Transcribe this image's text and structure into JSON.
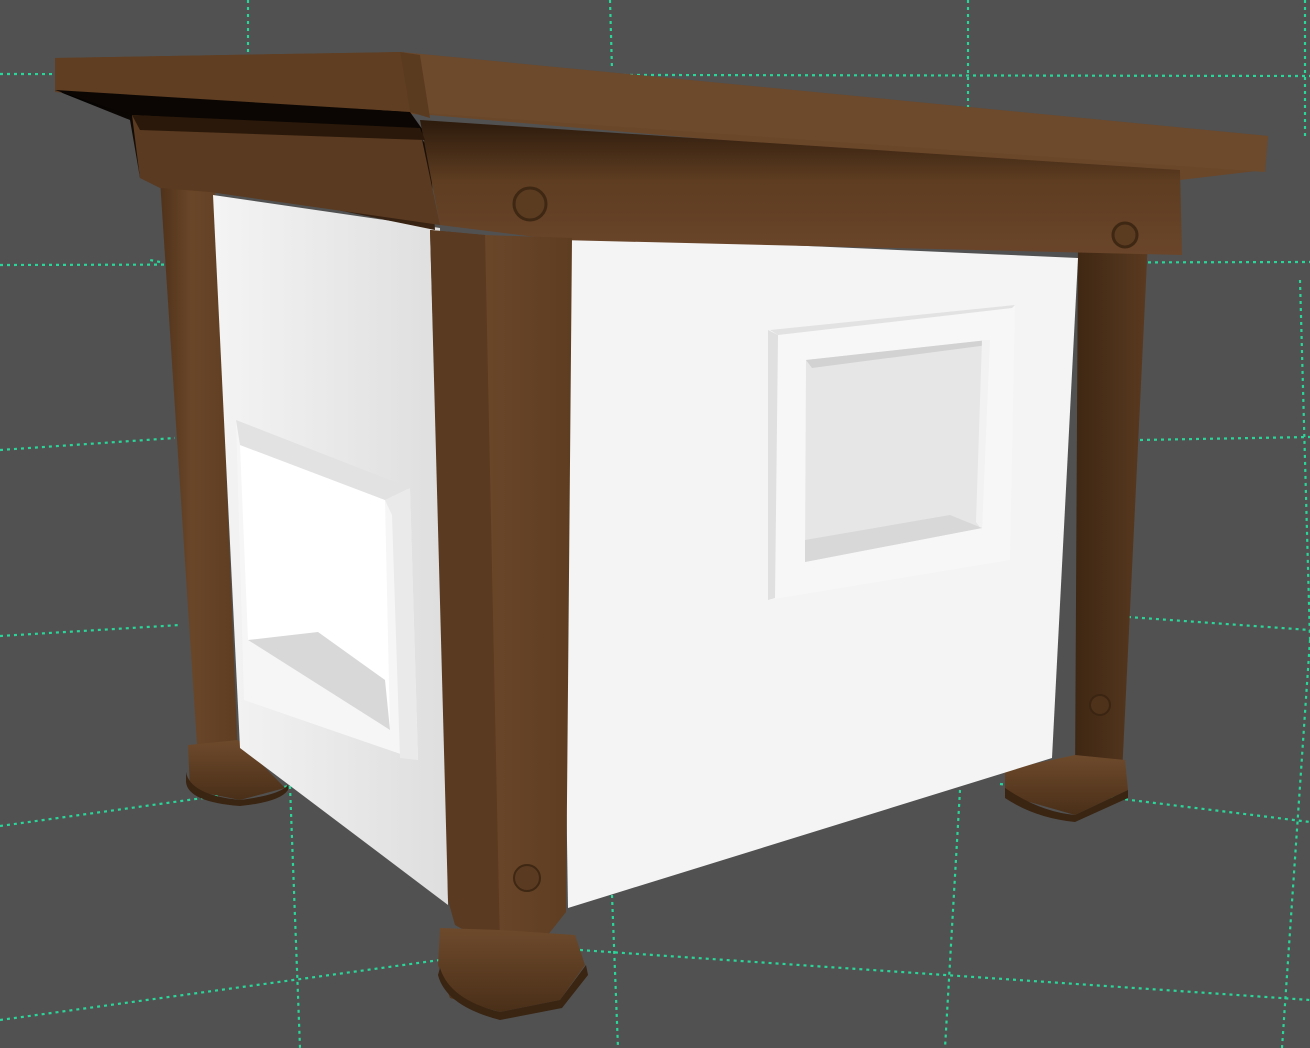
{
  "viewport": {
    "view": "perspective",
    "background_color": "#515151",
    "grid": {
      "visible": true,
      "color": "#2bd69a",
      "style": "dashed"
    }
  },
  "scene": {
    "model": "hut",
    "materials": {
      "wood_top": "#6a4629",
      "wood_side": "#5a3a20",
      "wood_dark": "#3a2412",
      "wall_front": "#f4f4f4",
      "wall_side": "#e4e4e4",
      "window_recess": "#dcdcdc"
    }
  }
}
